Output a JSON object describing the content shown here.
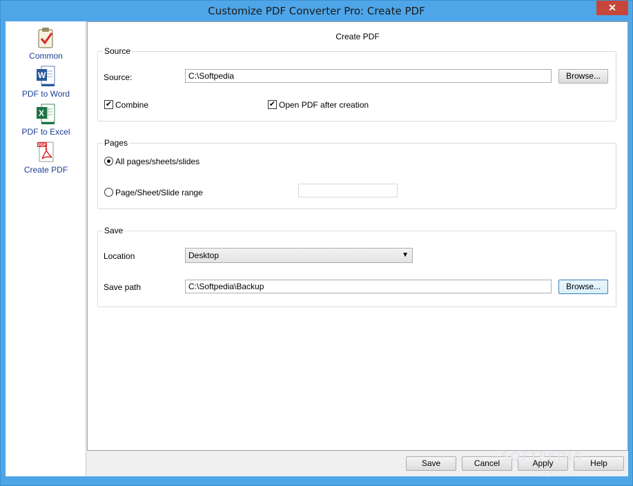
{
  "window": {
    "title": "Customize PDF Converter Pro: Create PDF",
    "close_glyph": "✕"
  },
  "sidebar": {
    "items": [
      {
        "label": "Common",
        "icon": "clipboard-check-icon"
      },
      {
        "label": "PDF to Word",
        "icon": "word-document-icon"
      },
      {
        "label": "PDF to Excel",
        "icon": "excel-document-icon"
      },
      {
        "label": "Create PDF",
        "icon": "pdf-document-icon"
      }
    ]
  },
  "content": {
    "page_title": "Create PDF",
    "source_group": {
      "title": "Source",
      "source_label": "Source:",
      "source_value": "C:\\Softpedia",
      "browse_label": "Browse...",
      "combine_label": "Combine",
      "combine_checked": true,
      "open_after_label": "Open PDF after creation",
      "open_after_checked": true
    },
    "pages_group": {
      "title": "Pages",
      "all_pages_label": "All pages/sheets/slides",
      "range_label": "Page/Sheet/Slide range",
      "range_value": "",
      "selected": "all"
    },
    "save_group": {
      "title": "Save",
      "location_label": "Location",
      "location_value": "Desktop",
      "save_path_label": "Save path",
      "save_path_value": "C:\\Softpedia\\Backup",
      "browse_label": "Browse..."
    }
  },
  "footer": {
    "save_label": "Save",
    "cancel_label": "Cancel",
    "apply_label": "Apply",
    "help_label": "Help"
  },
  "watermark": {
    "text": "SOFTPEDIA",
    "sub": "www.softpedia.com"
  },
  "colors": {
    "title_bar": "#4ea6e8",
    "close_button": "#c7463a",
    "sidebar_label": "#1c3f94"
  }
}
